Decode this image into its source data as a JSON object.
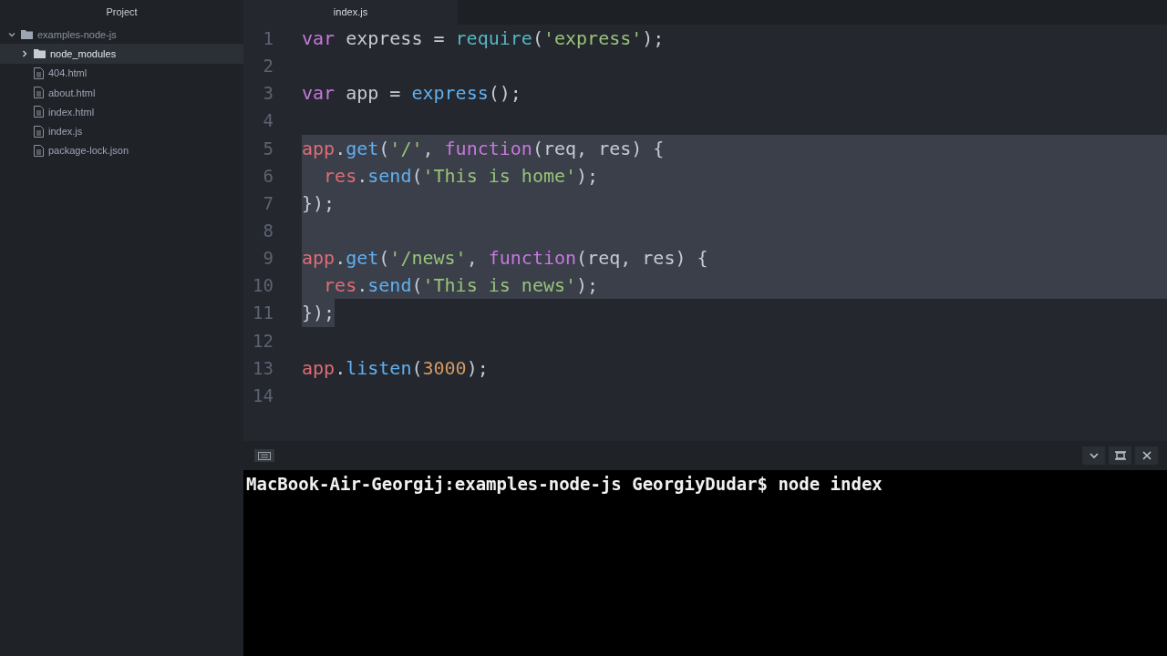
{
  "sidebar": {
    "title": "Project",
    "tree": [
      {
        "label": "examples-node-js",
        "kind": "folder",
        "expanded": true,
        "selected": false,
        "children": [
          {
            "label": "node_modules",
            "kind": "folder",
            "expanded": false,
            "selected": true
          },
          {
            "label": "404.html",
            "kind": "file",
            "selected": false
          },
          {
            "label": "about.html",
            "kind": "file",
            "selected": false
          },
          {
            "label": "index.html",
            "kind": "file",
            "selected": false
          },
          {
            "label": "index.js",
            "kind": "file",
            "selected": false
          },
          {
            "label": "package-lock.json",
            "kind": "file",
            "selected": false
          }
        ]
      }
    ]
  },
  "tabs": [
    {
      "label": "index.js",
      "selected": true
    }
  ],
  "editor": {
    "lines": [
      {
        "number": "1",
        "selected": false,
        "tokens": [
          {
            "kind": "keyword",
            "text": "var"
          },
          {
            "kind": "plain",
            "text": " express = "
          },
          {
            "kind": "builtin",
            "text": "require"
          },
          {
            "kind": "plain",
            "text": "("
          },
          {
            "kind": "string",
            "text": "'express'"
          },
          {
            "kind": "plain",
            "text": ");"
          }
        ]
      },
      {
        "number": "2",
        "selected": false
      },
      {
        "number": "3",
        "selected": false,
        "tokens": [
          {
            "kind": "keyword",
            "text": "var"
          },
          {
            "kind": "plain",
            "text": " app = "
          },
          {
            "kind": "function",
            "text": "express"
          },
          {
            "kind": "plain",
            "text": "();"
          }
        ]
      },
      {
        "number": "4",
        "selected": false
      },
      {
        "number": "5",
        "selected": true,
        "tokens": [
          {
            "kind": "object",
            "text": "app"
          },
          {
            "kind": "plain",
            "text": "."
          },
          {
            "kind": "function",
            "text": "get"
          },
          {
            "kind": "plain",
            "text": "("
          },
          {
            "kind": "string",
            "text": "'/'"
          },
          {
            "kind": "plain",
            "text": ", "
          },
          {
            "kind": "keyword",
            "text": "function"
          },
          {
            "kind": "plain",
            "text": "(req, res) {"
          }
        ]
      },
      {
        "number": "6",
        "selected": true,
        "tokens": [
          {
            "kind": "object",
            "text": "  res"
          },
          {
            "kind": "plain",
            "text": "."
          },
          {
            "kind": "function",
            "text": "send"
          },
          {
            "kind": "plain",
            "text": "("
          },
          {
            "kind": "string",
            "text": "'This is home'"
          },
          {
            "kind": "plain",
            "text": ");"
          }
        ]
      },
      {
        "number": "7",
        "selected": true,
        "tokens": [
          {
            "kind": "plain",
            "text": "});"
          }
        ]
      },
      {
        "number": "8",
        "selected": true
      },
      {
        "number": "9",
        "selected": true,
        "tokens": [
          {
            "kind": "object",
            "text": "app"
          },
          {
            "kind": "plain",
            "text": "."
          },
          {
            "kind": "function",
            "text": "get"
          },
          {
            "kind": "plain",
            "text": "("
          },
          {
            "kind": "string",
            "text": "'/news'"
          },
          {
            "kind": "plain",
            "text": ", "
          },
          {
            "kind": "keyword",
            "text": "function"
          },
          {
            "kind": "plain",
            "text": "(req, res) {"
          }
        ]
      },
      {
        "number": "10",
        "selected": true,
        "tokens": [
          {
            "kind": "object",
            "text": "  res"
          },
          {
            "kind": "plain",
            "text": "."
          },
          {
            "kind": "function",
            "text": "send"
          },
          {
            "kind": "plain",
            "text": "("
          },
          {
            "kind": "string",
            "text": "'This is news'"
          },
          {
            "kind": "plain",
            "text": ");"
          }
        ]
      },
      {
        "number": "11",
        "selected": true,
        "tokens": [
          {
            "kind": "plain",
            "text": "});"
          }
        ]
      },
      {
        "number": "12",
        "selected": false
      },
      {
        "number": "13",
        "selected": false,
        "tokens": [
          {
            "kind": "object",
            "text": "app"
          },
          {
            "kind": "plain",
            "text": "."
          },
          {
            "kind": "function",
            "text": "listen"
          },
          {
            "kind": "plain",
            "text": "("
          },
          {
            "kind": "number",
            "text": "3000"
          },
          {
            "kind": "plain",
            "text": ");"
          }
        ]
      },
      {
        "number": "14",
        "selected": false
      }
    ]
  },
  "terminal": {
    "lines": [
      "MacBook-Air-Georgij:examples-node-js GeorgiyDudar$ node index"
    ]
  }
}
